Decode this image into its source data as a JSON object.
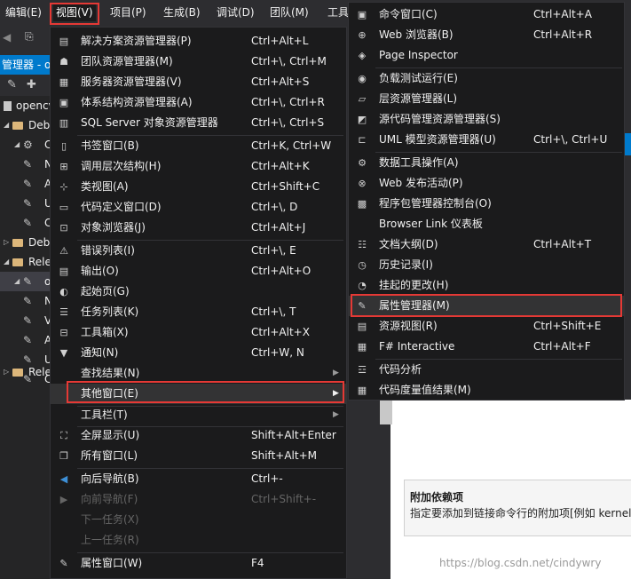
{
  "menubar": {
    "items": [
      {
        "label": "编辑(E)"
      },
      {
        "label": "视图(V)"
      },
      {
        "label": "项目(P)"
      },
      {
        "label": "生成(B)"
      },
      {
        "label": "调试(D)"
      },
      {
        "label": "团队(M)"
      },
      {
        "label": "工具"
      }
    ]
  },
  "solution_explorer": {
    "title": "管理器 - o",
    "tree": [
      {
        "label": "opencv"
      },
      {
        "label": "Deb"
      },
      {
        "label": "C"
      },
      {
        "label": "N"
      },
      {
        "label": "A"
      },
      {
        "label": "U"
      },
      {
        "label": "C"
      },
      {
        "label": "Deb"
      },
      {
        "label": "Rele"
      },
      {
        "label": "o"
      },
      {
        "label": "N"
      },
      {
        "label": "V"
      },
      {
        "label": "A"
      },
      {
        "label": "U"
      },
      {
        "label": "C"
      },
      {
        "label": "Rele"
      }
    ]
  },
  "view_menu": {
    "items": [
      {
        "label": "解决方案资源管理器(P)",
        "shortcut": "Ctrl+Alt+L",
        "icon": "solution-explorer-icon"
      },
      {
        "label": "团队资源管理器(M)",
        "shortcut": "Ctrl+\\, Ctrl+M",
        "icon": "team-explorer-icon"
      },
      {
        "label": "服务器资源管理器(V)",
        "shortcut": "Ctrl+Alt+S",
        "icon": "server-explorer-icon"
      },
      {
        "label": "体系结构资源管理器(A)",
        "shortcut": "Ctrl+\\, Ctrl+R",
        "icon": "architecture-explorer-icon"
      },
      {
        "label": "SQL Server 对象资源管理器",
        "shortcut": "Ctrl+\\, Ctrl+S",
        "icon": "sql-server-icon"
      },
      {
        "label": "书签窗口(B)",
        "shortcut": "Ctrl+K, Ctrl+W",
        "icon": "bookmark-icon"
      },
      {
        "label": "调用层次结构(H)",
        "shortcut": "Ctrl+Alt+K",
        "icon": "call-hierarchy-icon"
      },
      {
        "label": "类视图(A)",
        "shortcut": "Ctrl+Shift+C",
        "icon": "class-view-icon"
      },
      {
        "label": "代码定义窗口(D)",
        "shortcut": "Ctrl+\\, D",
        "icon": "code-definition-icon"
      },
      {
        "label": "对象浏览器(J)",
        "shortcut": "Ctrl+Alt+J",
        "icon": "object-browser-icon"
      },
      {
        "label": "错误列表(I)",
        "shortcut": "Ctrl+\\, E",
        "icon": "error-list-icon"
      },
      {
        "label": "输出(O)",
        "shortcut": "Ctrl+Alt+O",
        "icon": "output-icon"
      },
      {
        "label": "起始页(G)",
        "shortcut": "",
        "icon": "start-page-icon"
      },
      {
        "label": "任务列表(K)",
        "shortcut": "Ctrl+\\, T",
        "icon": "task-list-icon"
      },
      {
        "label": "工具箱(X)",
        "shortcut": "Ctrl+Alt+X",
        "icon": "toolbox-icon"
      },
      {
        "label": "通知(N)",
        "shortcut": "Ctrl+W, N",
        "icon": "notifications-icon"
      },
      {
        "label": "查找结果(N)",
        "shortcut": "",
        "icon": ""
      },
      {
        "label": "其他窗口(E)",
        "shortcut": "",
        "icon": ""
      },
      {
        "label": "工具栏(T)",
        "shortcut": "",
        "icon": ""
      },
      {
        "label": "全屏显示(U)",
        "shortcut": "Shift+Alt+Enter",
        "icon": "full-screen-icon"
      },
      {
        "label": "所有窗口(L)",
        "shortcut": "Shift+Alt+M",
        "icon": "all-windows-icon"
      },
      {
        "label": "向后导航(B)",
        "shortcut": "Ctrl+-",
        "icon": "navigate-back-icon"
      },
      {
        "label": "向前导航(F)",
        "shortcut": "Ctrl+Shift+-",
        "icon": "navigate-forward-icon"
      },
      {
        "label": "下一任务(X)",
        "shortcut": "",
        "icon": ""
      },
      {
        "label": "上一任务(R)",
        "shortcut": "",
        "icon": ""
      },
      {
        "label": "属性窗口(W)",
        "shortcut": "F4",
        "icon": "properties-window-icon"
      }
    ]
  },
  "other_windows_menu": {
    "items": [
      {
        "label": "命令窗口(C)",
        "shortcut": "Ctrl+Alt+A",
        "icon": "command-window-icon"
      },
      {
        "label": "Web 浏览器(B)",
        "shortcut": "Ctrl+Alt+R",
        "icon": "web-browser-icon"
      },
      {
        "label": "Page Inspector",
        "shortcut": "",
        "icon": "page-inspector-icon"
      },
      {
        "label": "负载测试运行(E)",
        "shortcut": "",
        "icon": "load-test-icon"
      },
      {
        "label": "层资源管理器(L)",
        "shortcut": "",
        "icon": "layer-explorer-icon"
      },
      {
        "label": "源代码管理资源管理器(S)",
        "shortcut": "",
        "icon": "source-control-icon"
      },
      {
        "label": "UML 模型资源管理器(U)",
        "shortcut": "Ctrl+\\, Ctrl+U",
        "icon": "uml-model-icon"
      },
      {
        "label": "数据工具操作(A)",
        "shortcut": "",
        "icon": "data-tools-icon"
      },
      {
        "label": "Web 发布活动(P)",
        "shortcut": "",
        "icon": "web-publish-icon"
      },
      {
        "label": "程序包管理器控制台(O)",
        "shortcut": "",
        "icon": "package-manager-icon"
      },
      {
        "label": "Browser Link 仪表板",
        "shortcut": "",
        "icon": "browser-link-icon"
      },
      {
        "label": "文档大纲(D)",
        "shortcut": "Ctrl+Alt+T",
        "icon": "document-outline-icon"
      },
      {
        "label": "历史记录(I)",
        "shortcut": "",
        "icon": "history-icon"
      },
      {
        "label": "挂起的更改(H)",
        "shortcut": "",
        "icon": "pending-changes-icon"
      },
      {
        "label": "属性管理器(M)",
        "shortcut": "",
        "icon": "property-manager-icon"
      },
      {
        "label": "资源视图(R)",
        "shortcut": "Ctrl+Shift+E",
        "icon": "resource-view-icon"
      },
      {
        "label": "F# Interactive",
        "shortcut": "Ctrl+Alt+F",
        "icon": "fsharp-interactive-icon"
      },
      {
        "label": "代码分析",
        "shortcut": "",
        "icon": "code-analysis-icon"
      },
      {
        "label": "代码度量值结果(M)",
        "shortcut": "",
        "icon": "code-metrics-icon"
      }
    ]
  },
  "right_panel": {
    "title": "附加依赖项",
    "description": "指定要添加到链接命令行的附加项[例如 kernel"
  },
  "watermark": "https://blog.csdn.net/cindywry",
  "colors": {
    "highlight_box": "#e53935",
    "menu_bg": "#1b1b1c",
    "accent": "#007acc"
  }
}
